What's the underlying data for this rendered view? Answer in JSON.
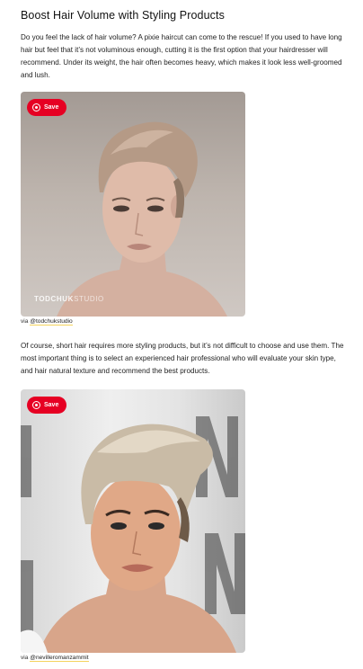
{
  "article": {
    "heading": "Boost Hair Volume with Styling Products",
    "paragraph_1": "Do you feel the lack of hair volume? A pixie haircut can come to the rescue! If you used to have long hair but feel that it’s not voluminous enough, cutting it is the first option that your hairdresser will recommend. Under its weight, the hair often becomes heavy, which makes it look less well-groomed and lush.",
    "paragraph_2": "Of course, short hair requires more styling products, but it’s not difficult to choose and use them. The most important thing is to select an experienced hair professional who will evaluate your skin type, and hair natural texture and recommend the best products."
  },
  "images": [
    {
      "save_label": "Save",
      "icon": "pinterest-icon",
      "watermark_bold": "TODCHUK",
      "watermark_light": "STUDIO",
      "credit_prefix": "via",
      "credit_link": "@todchukstudio"
    },
    {
      "save_label": "Save",
      "icon": "pinterest-icon",
      "credit_prefix": "via",
      "credit_link": "@nevilleromanzammit"
    }
  ],
  "colors": {
    "save_button": "#e60023",
    "link_underline": "#f4d35e"
  }
}
